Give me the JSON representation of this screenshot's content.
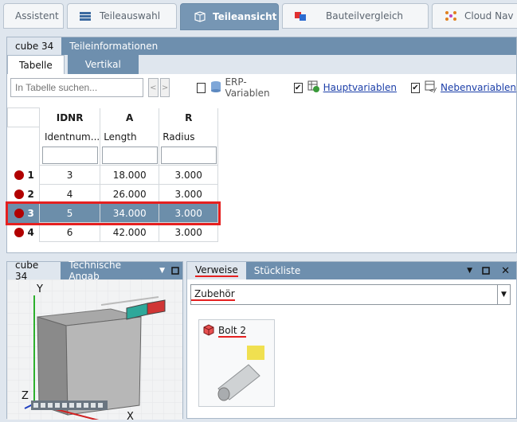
{
  "top_tabs": [
    {
      "label": "Assistent"
    },
    {
      "label": "Teileauswahl"
    },
    {
      "label": "Teileansicht"
    },
    {
      "label": "Bauteilvergleich"
    },
    {
      "label": "Cloud Nav"
    }
  ],
  "table_panel": {
    "tabs": [
      "cube 34",
      "Teileinformationen"
    ],
    "subtabs": [
      "Tabelle",
      "Vertikal"
    ],
    "search_placeholder": "In Tabelle suchen...",
    "nav_prev": "<",
    "nav_next": ">",
    "options": [
      {
        "label": "ERP-Variablen",
        "checked": false
      },
      {
        "label": "Hauptvariablen",
        "checked": true
      },
      {
        "label": "Nebenvariablen",
        "checked": true
      }
    ],
    "columns": [
      {
        "key": "IDNR",
        "desc": "Identnum..."
      },
      {
        "key": "A",
        "desc": "Length"
      },
      {
        "key": "R",
        "desc": "Radius"
      }
    ],
    "rows": [
      {
        "num": "1",
        "idnr": "3",
        "a": "18.000",
        "r": "3.000"
      },
      {
        "num": "2",
        "idnr": "4",
        "a": "26.000",
        "r": "3.000"
      },
      {
        "num": "3",
        "idnr": "5",
        "a": "34.000",
        "r": "3.000"
      },
      {
        "num": "4",
        "idnr": "6",
        "a": "42.000",
        "r": "3.000"
      }
    ]
  },
  "viewer_panel": {
    "tabs": [
      "cube 34",
      "Technische Angab"
    ],
    "axis_x": "X",
    "axis_y": "Y",
    "axis_z": "Z"
  },
  "refs_panel": {
    "tabs": [
      "Verweise",
      "Stückliste"
    ],
    "dropdown_value": "Zubehör",
    "item_label": "Bolt 2"
  },
  "colors": {
    "accent": "#6e8fae",
    "highlight": "#e52020",
    "row_dot": "#b10000"
  }
}
